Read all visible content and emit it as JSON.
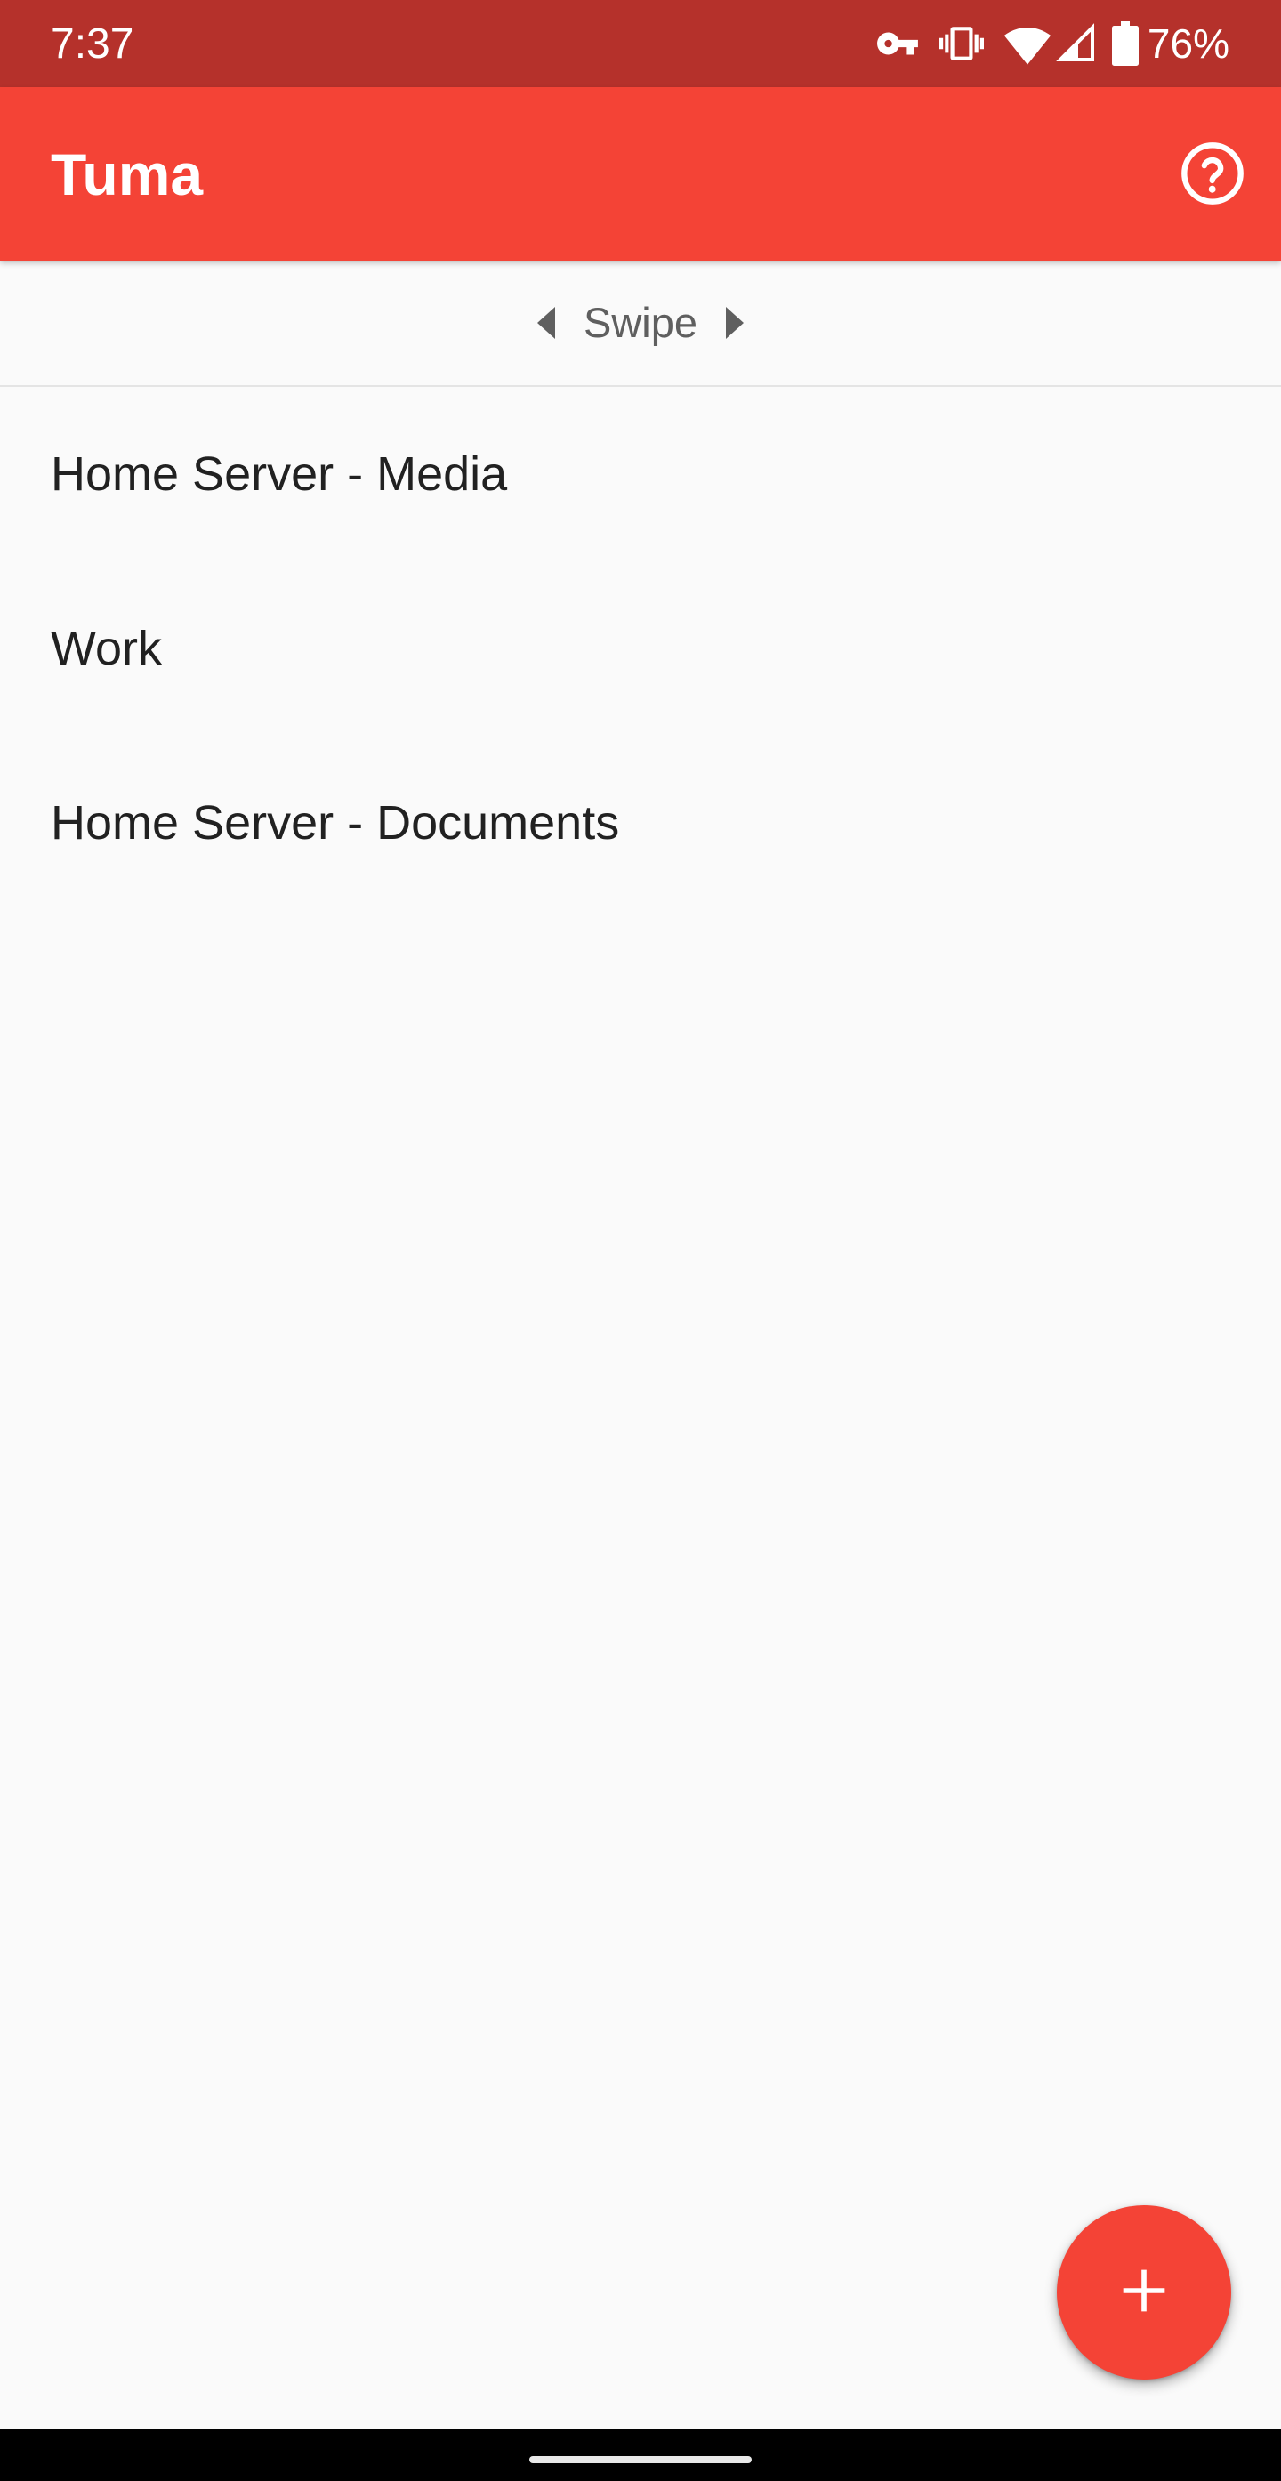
{
  "status_bar": {
    "time": "7:37",
    "battery": "76%",
    "icons": [
      "vpn-key-icon",
      "vibrate-icon",
      "wifi-icon",
      "cell-signal-icon",
      "battery-icon"
    ]
  },
  "app_bar": {
    "title": "Tuma",
    "help_icon": "help-circle-icon"
  },
  "swipe_hint": {
    "label": "Swipe",
    "left_icon": "arrow-left-icon",
    "right_icon": "arrow-right-icon"
  },
  "servers": [
    {
      "name": "Home Server - Media"
    },
    {
      "name": "Work"
    },
    {
      "name": "Home Server - Documents"
    }
  ],
  "fab": {
    "icon": "plus-icon"
  },
  "colors": {
    "primary": "#f44336",
    "primary_dark": "#b5312b",
    "background": "#fafafa",
    "text": "#212121",
    "hint_text": "#5f5f5f"
  }
}
